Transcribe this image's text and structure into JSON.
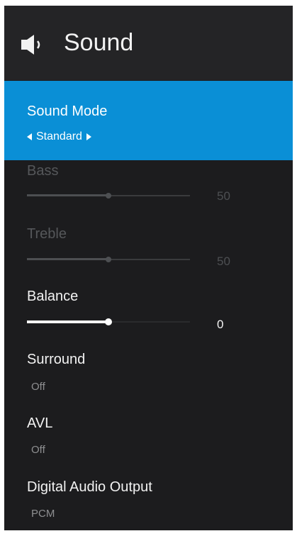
{
  "header": {
    "title": "Sound",
    "icon": "speaker-icon"
  },
  "sound_mode": {
    "label": "Sound Mode",
    "value": "Standard"
  },
  "bass": {
    "label": "Bass",
    "value": "50",
    "level": 0.5
  },
  "treble": {
    "label": "Treble",
    "value": "50",
    "level": 0.5
  },
  "balance": {
    "label": "Balance",
    "value": "0",
    "level": 0.5
  },
  "surround": {
    "label": "Surround",
    "value": "Off"
  },
  "avl": {
    "label": "AVL",
    "value": "Off"
  },
  "digital_audio_output": {
    "label": "Digital Audio Output",
    "value": "PCM"
  },
  "colors": {
    "accent": "#0a8fd6",
    "background": "#1c1c1e",
    "header": "#242426"
  }
}
